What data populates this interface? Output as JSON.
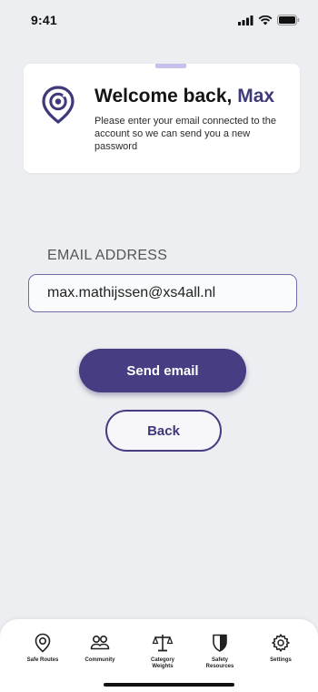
{
  "status_bar": {
    "time": "9:41"
  },
  "card": {
    "greeting": "Welcome back,",
    "user_name": "Max",
    "message": "Please enter your email connected to the account so we can send you a new password"
  },
  "form": {
    "email_label": "EMAIL ADDRESS",
    "email_value": "max.mathijssen@xs4all.nl"
  },
  "buttons": {
    "send_label": "Send email",
    "back_label": "Back"
  },
  "tab_bar": {
    "items": [
      {
        "label": "Safe Routes",
        "icon": "location-pin-icon"
      },
      {
        "label": "Community",
        "icon": "people-icon"
      },
      {
        "label": "Category\nWeights",
        "icon": "scales-icon"
      },
      {
        "label": "Safety\nResources",
        "icon": "shield-icon"
      },
      {
        "label": "Settings",
        "icon": "gear-icon"
      }
    ]
  },
  "colors": {
    "accent": "#463d82",
    "accent_light": "#c8c0ec",
    "background": "#eceef1"
  }
}
